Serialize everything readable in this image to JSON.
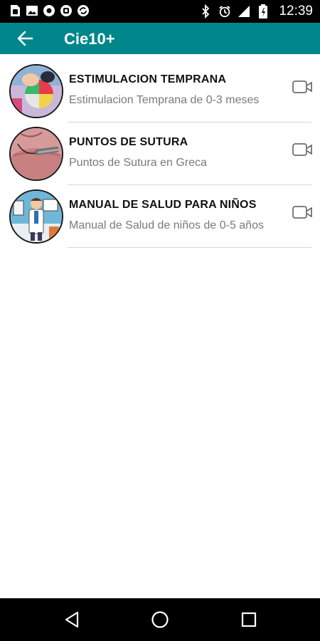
{
  "status_bar": {
    "time": "12:39",
    "icons": [
      "sim-card-icon",
      "image-icon",
      "circle-dot-icon",
      "s-logo-icon",
      "sync-logo-icon",
      "bluetooth-icon",
      "alarm-icon",
      "signal-icon",
      "battery-icon"
    ]
  },
  "app_bar": {
    "title": "Cie10+",
    "back_icon": "arrow-left-icon",
    "color": "#00868b"
  },
  "items": [
    {
      "title": "ESTIMULACION TEMPRANA",
      "subtitle": "Estimulacion Temprana de 0-3 meses",
      "thumbnail": "baby-with-ball-photo",
      "action_icon": "video-camera-icon"
    },
    {
      "title": "PUNTOS DE SUTURA",
      "subtitle": "Puntos de Sutura en Greca",
      "thumbnail": "suture-stitch-photo",
      "action_icon": "video-camera-icon"
    },
    {
      "title": "MANUAL DE SALUD PARA NIÑOS",
      "subtitle": "Manual de Salud de niños de 0-5 años",
      "thumbnail": "doctor-illustration",
      "action_icon": "video-camera-icon"
    }
  ],
  "nav_bar": {
    "icons": [
      "back-triangle-icon",
      "home-circle-icon",
      "recents-square-icon"
    ]
  }
}
